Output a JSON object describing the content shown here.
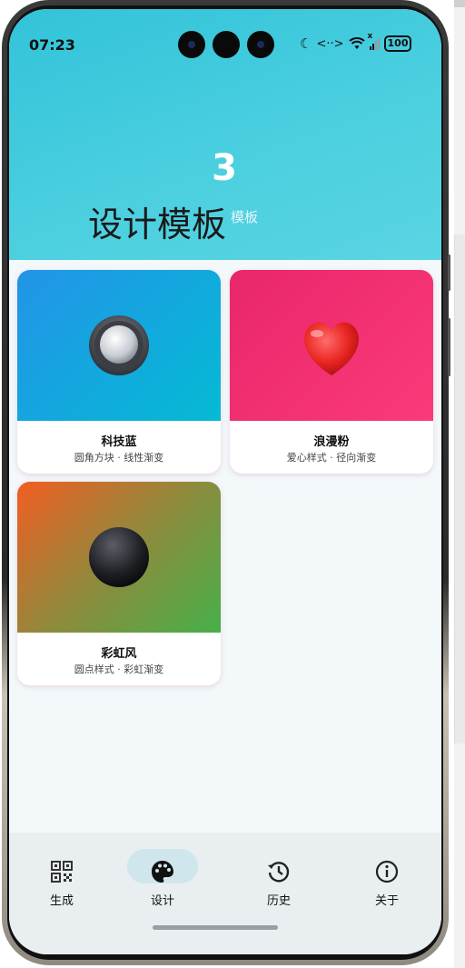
{
  "status_bar": {
    "time": "07:23",
    "wifi_mark": "x",
    "battery": "100"
  },
  "header": {
    "count": "3",
    "title": "设计模板",
    "subtitle": "模板"
  },
  "templates": [
    {
      "name": "科技蓝",
      "desc": "圆角方块 · 线性渐变",
      "icon": "ball-button-icon",
      "gradient": [
        "#2294e8",
        "#05bad4"
      ]
    },
    {
      "name": "浪漫粉",
      "desc": "爱心样式 · 径向渐变",
      "icon": "heart-icon",
      "gradient": [
        "#e8266a",
        "#fb3a7a"
      ]
    },
    {
      "name": "彩虹风",
      "desc": "圆点样式 · 彩虹渐变",
      "icon": "dark-sphere-icon",
      "gradient": [
        "#f25d22",
        "#46b04a"
      ]
    }
  ],
  "bottom_nav": {
    "items": [
      {
        "label": "生成",
        "icon": "qr-code-icon"
      },
      {
        "label": "设计",
        "icon": "palette-icon"
      },
      {
        "label": "历史",
        "icon": "history-icon"
      },
      {
        "label": "关于",
        "icon": "info-icon"
      }
    ],
    "active": "设计"
  },
  "colors": {
    "header_start": "#32c3d9",
    "header_end": "#5ad4e2",
    "nav_background": "#e9eef1",
    "active_pill": "#cfe6ec",
    "content_background": "#f3f8fb"
  }
}
